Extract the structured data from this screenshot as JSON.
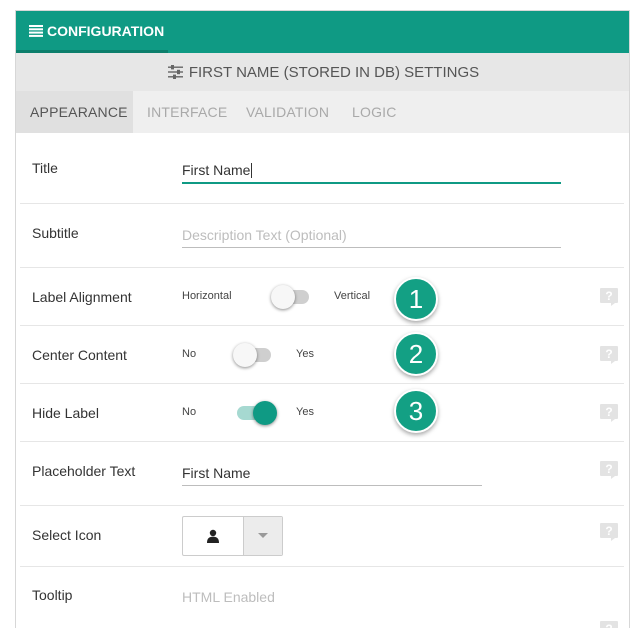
{
  "header": {
    "config_label": "CONFIGURATION",
    "config_icon": "list-icon",
    "settings_title": "FIRST NAME (STORED IN DB) SETTINGS",
    "settings_icon": "sliders-icon"
  },
  "tabs": [
    {
      "label": "APPEARANCE",
      "active": true
    },
    {
      "label": "INTERFACE",
      "active": false
    },
    {
      "label": "VALIDATION",
      "active": false
    },
    {
      "label": "LOGIC",
      "active": false
    }
  ],
  "fields": {
    "title": {
      "label": "Title",
      "value": "First Name"
    },
    "subtitle": {
      "label": "Subtitle",
      "placeholder": "Description Text (Optional)"
    },
    "label_alignment": {
      "label": "Label Alignment",
      "left": "Horizontal",
      "right": "Vertical",
      "on": false,
      "badge": "1"
    },
    "center_content": {
      "label": "Center Content",
      "left": "No",
      "right": "Yes",
      "on": false,
      "badge": "2"
    },
    "hide_label": {
      "label": "Hide Label",
      "left": "No",
      "right": "Yes",
      "on": true,
      "badge": "3"
    },
    "placeholder_text": {
      "label": "Placeholder Text",
      "value": "First Name"
    },
    "select_icon": {
      "label": "Select Icon",
      "icon": "user-icon"
    },
    "tooltip": {
      "label": "Tooltip",
      "placeholder": "HTML Enabled"
    }
  },
  "colors": {
    "accent": "#0f9a84",
    "badge": "#13a084",
    "help_icon": "#e3e3e3"
  }
}
